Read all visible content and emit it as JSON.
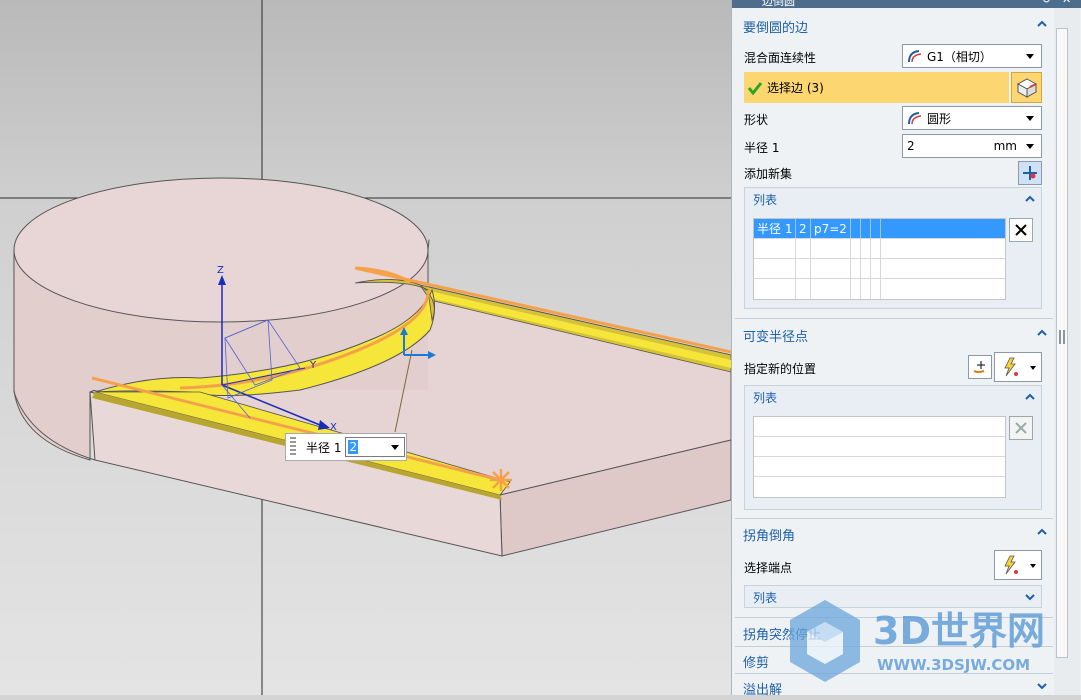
{
  "dialog": {
    "title": "边倒圆",
    "sections": {
      "edges": {
        "title": "要倒圆的边",
        "continuity_label": "混合面连续性",
        "continuity_value": "G1（相切）",
        "select_edge_label": "选择边 (3)",
        "shape_label": "形状",
        "shape_value": "圆形",
        "radius_label": "半径 1",
        "radius_value": "2",
        "radius_unit": "mm",
        "add_set_label": "添加新集",
        "list_title": "列表",
        "list_rows": [
          {
            "c1": "半径 1",
            "c2": "2",
            "c3": "p7=2"
          }
        ]
      },
      "variable_radius": {
        "title": "可变半径点",
        "specify_label": "指定新的位置",
        "list_title": "列表"
      },
      "corner_setback": {
        "title": "拐角倒角",
        "select_endpoint_label": "选择端点",
        "list_title": "列表"
      },
      "corner_stop": {
        "title": "拐角突然停止"
      },
      "trim": {
        "title": "修剪"
      },
      "overflow": {
        "title": "溢出解"
      }
    }
  },
  "viewport": {
    "dynamic_input": {
      "label": "半径 1",
      "value": "2"
    },
    "triad": {
      "z": "Z",
      "y": "Y",
      "x": "X"
    }
  },
  "watermark": {
    "brand": "3D世界网",
    "url": "WWW.3DSJW.COM"
  },
  "colors": {
    "accent_blue": "#1e5fa8",
    "selection_yellow": "#fcd670",
    "fillet_yellow": "#f6e63a",
    "edge_orange": "#f5a14a",
    "solid_pink": "#e7d4d4"
  }
}
